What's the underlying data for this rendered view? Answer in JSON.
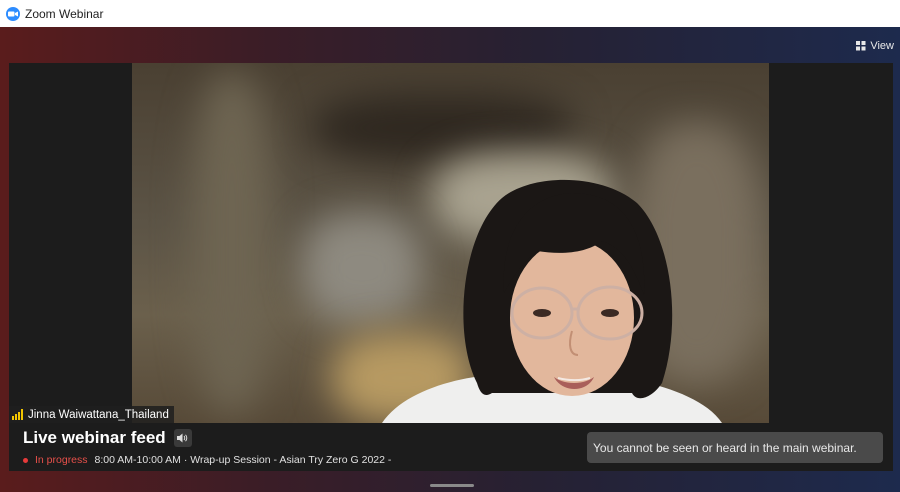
{
  "window": {
    "title": "Zoom Webinar",
    "icon": "zoom-logo"
  },
  "toolbar": {
    "view_label": "View",
    "view_icon": "grid-icon"
  },
  "video": {
    "participant_name": "Jinna Waiwattana_Thailand",
    "signal_icon": "signal-bars-icon",
    "signal_color": "#f2c500"
  },
  "feed": {
    "title": "Live webinar feed",
    "speaker_icon": "speaker-icon",
    "status": "In progress",
    "status_color": "#e6504a",
    "schedule": "8:00 AM-10:00 AM · Wrap-up Session - Asian Try Zero G 2022 -"
  },
  "notice": {
    "text": "You cannot be seen or heard in the main webinar."
  }
}
